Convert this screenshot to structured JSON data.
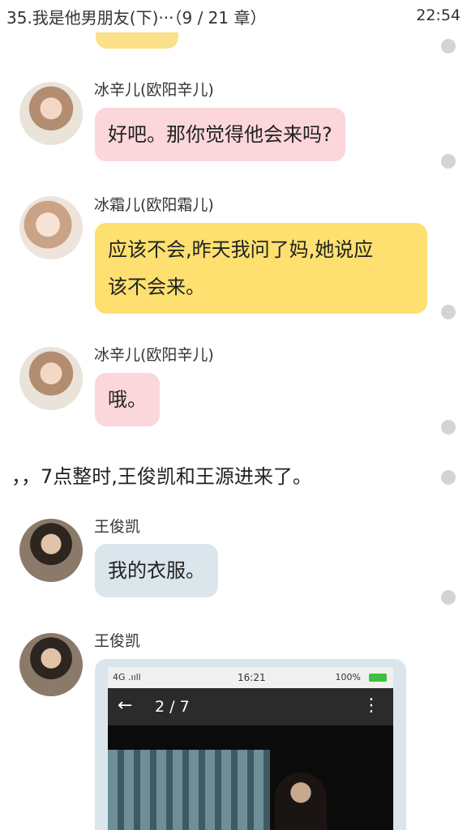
{
  "status_bar": {
    "title": "35.我是他男朋友(下)···（9 / 21 章）",
    "time": "22:54"
  },
  "messages": [
    {
      "sender": "冰辛儿(欧阳辛儿)",
      "lines": [
        "好吧。那你觉得他会来吗?"
      ],
      "color": "#fbd6da",
      "avatar": "avatar-bing"
    },
    {
      "sender": "冰霜儿(欧阳霜儿)",
      "lines": [
        "应该不会,昨天我问了妈,她说应",
        "该不会来。"
      ],
      "color": "#fde070",
      "avatar": "avatar-shuang"
    },
    {
      "sender": "冰辛儿(欧阳辛儿)",
      "lines": [
        "哦。"
      ],
      "color": "#fbd6da",
      "avatar": "avatar-bing"
    },
    {
      "sender": "王俊凯",
      "lines": [
        "我的衣服。"
      ],
      "color": "#dbe5ec",
      "avatar": "avatar-wang"
    },
    {
      "sender": "王俊凯",
      "image": true,
      "avatar": "avatar-wang"
    }
  ],
  "narration": "，，7点整时,王俊凯和王源进来了。",
  "screenshot": {
    "status_left": "4G .ııll",
    "time": "16:21",
    "status_right": "100%",
    "pager": "2 / 7"
  }
}
